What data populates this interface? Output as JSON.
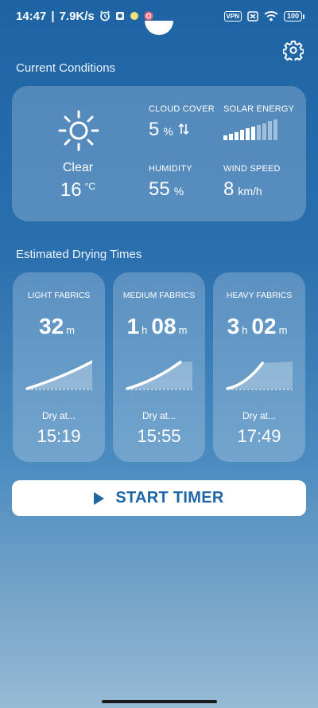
{
  "status_bar": {
    "time": "14:47",
    "net_speed": "7.9K/s",
    "vpn": "VPN",
    "battery": "100",
    "icons": [
      "alarm-icon",
      "square-icon",
      "dot-icon",
      "notification-icon",
      "vpn-icon",
      "sim-icon",
      "wifi-icon",
      "battery-icon"
    ]
  },
  "settings_icon": "gear-icon",
  "current": {
    "title": "Current Conditions",
    "condition": "Clear",
    "temperature": "16",
    "temp_unit": "°C",
    "cloud_cover": {
      "label": "CLOUD COVER",
      "value": "5",
      "unit": "%"
    },
    "solar_energy": {
      "label": "SOLAR ENERGY",
      "levels": 10,
      "filled": 6
    },
    "humidity": {
      "label": "HUMIDITY",
      "value": "55",
      "unit": "%"
    },
    "wind_speed": {
      "label": "WIND SPEED",
      "value": "8",
      "unit": "km/h"
    }
  },
  "drying": {
    "title": "Estimated Drying Times",
    "cards": [
      {
        "label": "LIGHT FABRICS",
        "hours": "",
        "minutes": "32",
        "dry_at_label": "Dry at...",
        "dry_at": "15:19",
        "progress": 1.0
      },
      {
        "label": "MEDIUM FABRICS",
        "hours": "1",
        "minutes": "08",
        "dry_at_label": "Dry at...",
        "dry_at": "15:55",
        "progress": 0.82
      },
      {
        "label": "HEAVY FABRICS",
        "hours": "3",
        "minutes": "02",
        "dry_at_label": "Dry at...",
        "dry_at": "17:49",
        "progress": 0.55
      }
    ],
    "unit_h": "h",
    "unit_m": "m"
  },
  "start_button": {
    "label": "START TIMER"
  }
}
